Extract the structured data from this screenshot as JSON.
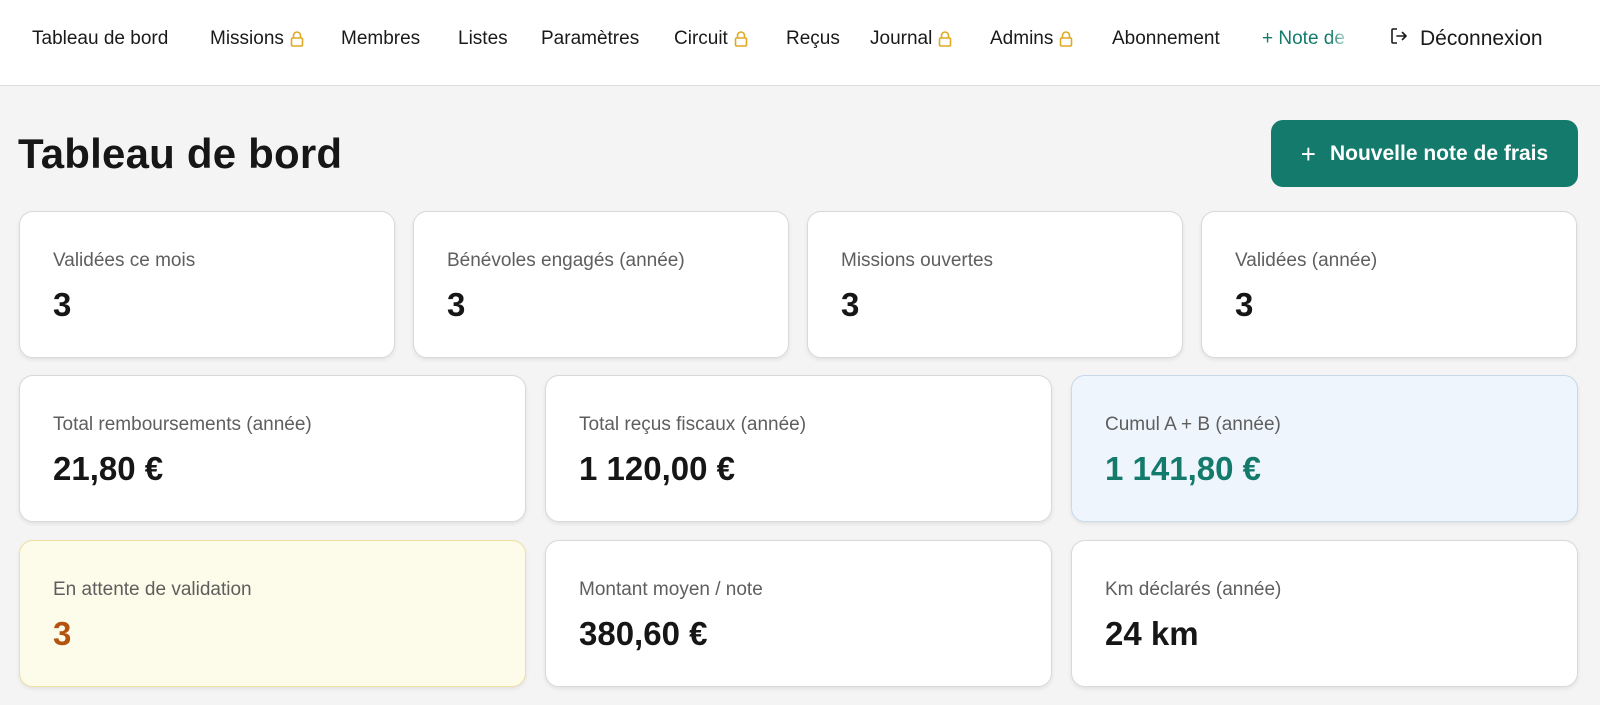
{
  "nav": {
    "items": [
      {
        "label": "Tableau de bord",
        "locked": false
      },
      {
        "label": "Missions",
        "locked": true
      },
      {
        "label": "Membres",
        "locked": false
      },
      {
        "label": "Listes",
        "locked": false
      },
      {
        "label": "Paramètres",
        "locked": false
      },
      {
        "label": "Circuit",
        "locked": true
      },
      {
        "label": "Reçus",
        "locked": false
      },
      {
        "label": "Journal",
        "locked": true
      },
      {
        "label": "Admins",
        "locked": true
      },
      {
        "label": "Abonnement",
        "locked": false
      }
    ],
    "new_note_label": "+ Note de",
    "logout_label": "Déconnexion",
    "accent_color": "#137a6c",
    "lock_color": "#e0a825"
  },
  "header": {
    "title": "Tableau de bord",
    "new_button_label": "Nouvelle note de frais",
    "button_color": "#137a6c"
  },
  "stats": {
    "row1": [
      {
        "label": "Validées ce mois",
        "value": "3"
      },
      {
        "label": "Bénévoles engagés (année)",
        "value": "3"
      },
      {
        "label": "Missions ouvertes",
        "value": "3"
      },
      {
        "label": "Validées (année)",
        "value": "3"
      }
    ],
    "row2": [
      {
        "label": "Total remboursements (année)",
        "value": "21,80 €"
      },
      {
        "label": "Total reçus fiscaux (année)",
        "value": "1 120,00 €"
      },
      {
        "label": "Cumul A + B (année)",
        "value": "1 141,80 €"
      }
    ],
    "row3": [
      {
        "label": "En attente de validation",
        "value": "3"
      },
      {
        "label": "Montant moyen / note",
        "value": "380,60 €"
      },
      {
        "label": "Km déclarés (année)",
        "value": "24 km"
      }
    ]
  }
}
